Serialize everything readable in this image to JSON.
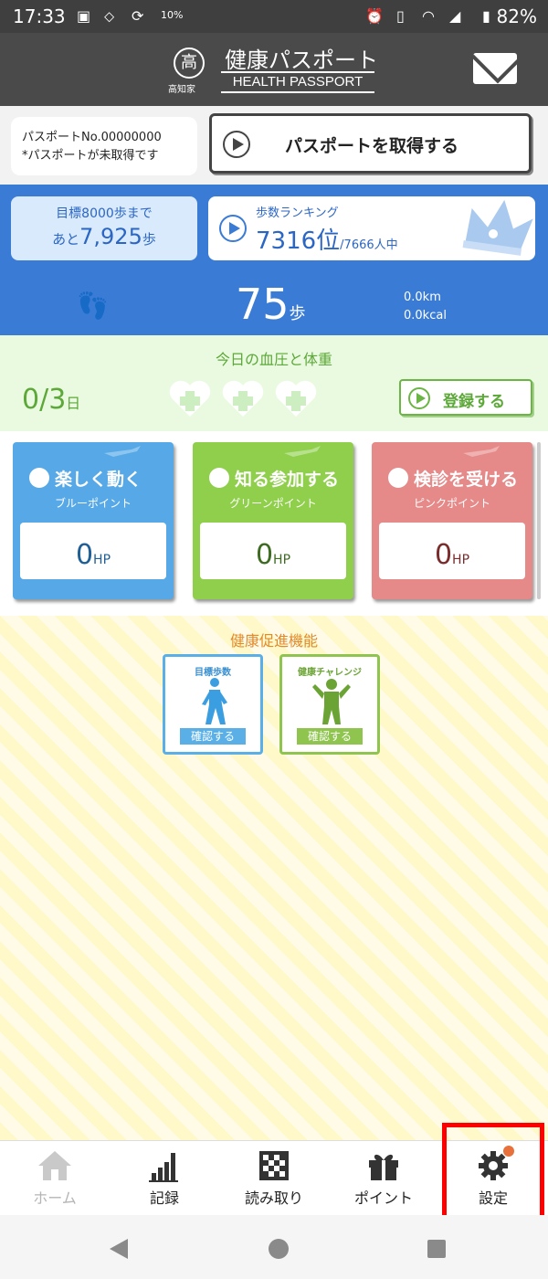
{
  "status_bar": {
    "time": "17:33",
    "temp": "10%",
    "battery": "82%"
  },
  "header": {
    "logo_char": "高",
    "logo_sub": "高知家",
    "title_jp": "健康パスポート",
    "title_en": "HEALTH PASSPORT"
  },
  "passport": {
    "number": "パスポートNo.00000000",
    "note": "*パスポートが未取得です",
    "button": "パスポートを取得する"
  },
  "steps": {
    "goal_line1": "目標8000歩まで",
    "goal_prefix": "あと",
    "goal_remaining": "7,925",
    "goal_unit": "歩",
    "ranking_title": "歩数ランキング",
    "ranking_pos": "7316位",
    "ranking_total": "/7666人中",
    "count": "75",
    "count_unit": "歩",
    "distance": "0.0km",
    "calories": "0.0kcal"
  },
  "blood_pressure": {
    "title": "今日の血圧と体重",
    "count": "0/3",
    "count_unit": "日",
    "button": "登録する"
  },
  "cards": {
    "blue": {
      "title": "楽しく動く",
      "sub": "ブルーポイント",
      "value": "0",
      "unit": "HP"
    },
    "green": {
      "title": "知る参加する",
      "sub": "グリーンポイント",
      "value": "0",
      "unit": "HP"
    },
    "pink": {
      "title": "検診を受ける",
      "sub": "ピンクポイント",
      "value": "0",
      "unit": "HP"
    }
  },
  "promo": {
    "title": "健康促進機能",
    "walk_caption": "目標歩数",
    "walk_button": "確認する",
    "challenge_caption": "健康チャレンジ",
    "challenge_button": "確認する"
  },
  "nav": {
    "home": "ホーム",
    "records": "記録",
    "scan": "読み取り",
    "points": "ポイント",
    "settings": "設定"
  },
  "colors": {
    "steps_blue": "#3a7bd5",
    "bp_green": "#5ca838",
    "highlight": "#ff0000"
  }
}
